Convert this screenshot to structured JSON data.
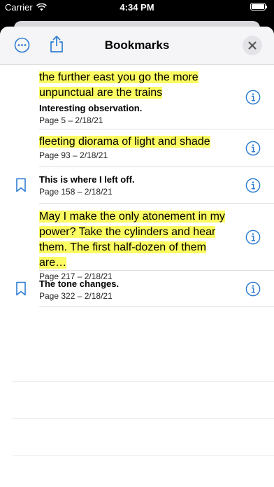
{
  "status_bar": {
    "carrier": "Carrier",
    "time": "4:34 PM"
  },
  "header": {
    "title": "Bookmarks"
  },
  "colors": {
    "accent": "#2f7dd1",
    "highlight": "#fbfb62"
  },
  "bookmarks": [
    {
      "highlight": "the further east you go the more unpunctual are the trains",
      "note": "Interesting observation.",
      "meta": "Page 5 – 2/18/21",
      "bookmark_icon": false
    },
    {
      "highlight": "fleeting diorama of light and shade",
      "note": "",
      "meta": "Page 93 – 2/18/21",
      "bookmark_icon": false
    },
    {
      "highlight": "",
      "note": "This is where I left off.",
      "meta": "Page 158 – 2/18/21",
      "bookmark_icon": true
    },
    {
      "highlight": "May I make the only atonement in my power? Take the cylinders and hear them. The first half-dozen of them are…",
      "note": "",
      "meta": "Page 217 – 2/18/21",
      "bookmark_icon": false
    },
    {
      "highlight": "",
      "note": "The tone changes.",
      "meta": "Page 322 – 2/18/21",
      "bookmark_icon": true
    }
  ],
  "icons": {
    "more": "ellipsis-circle-icon",
    "share": "share-icon",
    "close": "close-icon",
    "info": "info-circle-icon",
    "bookmark": "bookmark-icon"
  }
}
